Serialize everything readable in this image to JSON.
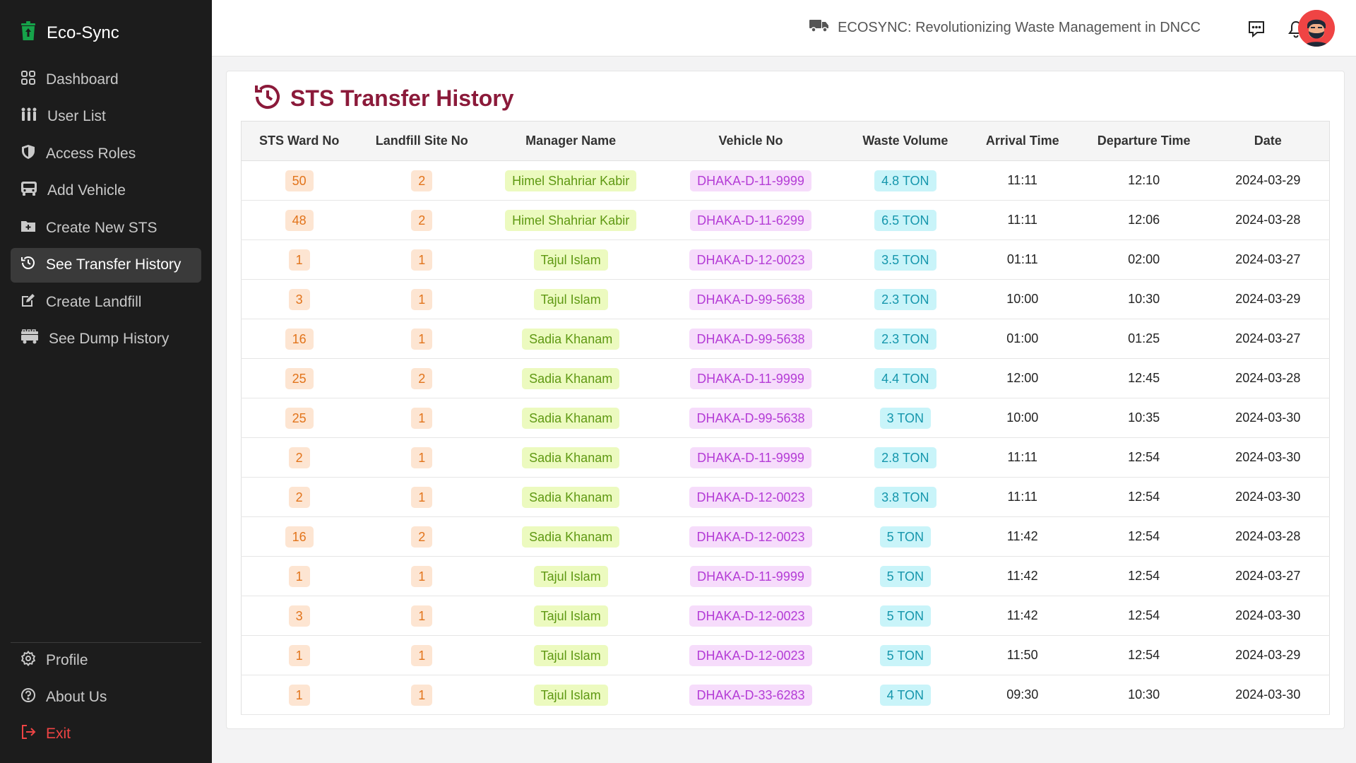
{
  "app": {
    "name": "Eco-Sync"
  },
  "sidebar": {
    "items": [
      {
        "label": "Dashboard",
        "icon": "dashboard-icon"
      },
      {
        "label": "User List",
        "icon": "users-icon"
      },
      {
        "label": "Access Roles",
        "icon": "shield-icon"
      },
      {
        "label": "Add Vehicle",
        "icon": "truck-icon"
      },
      {
        "label": "Create New STS",
        "icon": "folder-plus-icon"
      },
      {
        "label": "See Transfer History",
        "icon": "history-icon",
        "active": true
      },
      {
        "label": "Create Landfill",
        "icon": "edit-icon"
      },
      {
        "label": "See Dump History",
        "icon": "dump-truck-icon"
      }
    ],
    "bottom": [
      {
        "label": "Profile",
        "icon": "gear-icon"
      },
      {
        "label": "About Us",
        "icon": "help-icon"
      },
      {
        "label": "Exit",
        "icon": "exit-icon"
      }
    ]
  },
  "header": {
    "title": "ECOSYNC: Revolutionizing Waste Management in DNCC"
  },
  "page": {
    "title": "STS Transfer History"
  },
  "table": {
    "columns": [
      "STS Ward No",
      "Landfill Site No",
      "Manager Name",
      "Vehicle No",
      "Waste Volume",
      "Arrival Time",
      "Departure Time",
      "Date"
    ],
    "rows": [
      [
        "50",
        "2",
        "Himel Shahriar Kabir",
        "DHAKA-D-11-9999",
        "4.8 TON",
        "11:11",
        "12:10",
        "2024-03-29"
      ],
      [
        "48",
        "2",
        "Himel Shahriar Kabir",
        "DHAKA-D-11-6299",
        "6.5 TON",
        "11:11",
        "12:06",
        "2024-03-28"
      ],
      [
        "1",
        "1",
        "Tajul Islam",
        "DHAKA-D-12-0023",
        "3.5 TON",
        "01:11",
        "02:00",
        "2024-03-27"
      ],
      [
        "3",
        "1",
        "Tajul Islam",
        "DHAKA-D-99-5638",
        "2.3 TON",
        "10:00",
        "10:30",
        "2024-03-29"
      ],
      [
        "16",
        "1",
        "Sadia Khanam",
        "DHAKA-D-99-5638",
        "2.3 TON",
        "01:00",
        "01:25",
        "2024-03-27"
      ],
      [
        "25",
        "2",
        "Sadia Khanam",
        "DHAKA-D-11-9999",
        "4.4 TON",
        "12:00",
        "12:45",
        "2024-03-28"
      ],
      [
        "25",
        "1",
        "Sadia Khanam",
        "DHAKA-D-99-5638",
        "3 TON",
        "10:00",
        "10:35",
        "2024-03-30"
      ],
      [
        "2",
        "1",
        "Sadia Khanam",
        "DHAKA-D-11-9999",
        "2.8 TON",
        "11:11",
        "12:54",
        "2024-03-30"
      ],
      [
        "2",
        "1",
        "Sadia Khanam",
        "DHAKA-D-12-0023",
        "3.8 TON",
        "11:11",
        "12:54",
        "2024-03-30"
      ],
      [
        "16",
        "2",
        "Sadia Khanam",
        "DHAKA-D-12-0023",
        "5 TON",
        "11:42",
        "12:54",
        "2024-03-28"
      ],
      [
        "1",
        "1",
        "Tajul Islam",
        "DHAKA-D-11-9999",
        "5 TON",
        "11:42",
        "12:54",
        "2024-03-27"
      ],
      [
        "3",
        "1",
        "Tajul Islam",
        "DHAKA-D-12-0023",
        "5 TON",
        "11:42",
        "12:54",
        "2024-03-30"
      ],
      [
        "1",
        "1",
        "Tajul Islam",
        "DHAKA-D-12-0023",
        "5 TON",
        "11:50",
        "12:54",
        "2024-03-29"
      ],
      [
        "1",
        "1",
        "Tajul Islam",
        "DHAKA-D-33-6283",
        "4 TON",
        "09:30",
        "10:30",
        "2024-03-30"
      ]
    ]
  },
  "colors": {
    "sidebar_bg": "#1c1c1c",
    "title": "#8b1a3a",
    "exit": "#ef4444",
    "ward_pill": "#fde5d2",
    "manager_pill": "#ecfabf",
    "vehicle_pill": "#f6dcfb",
    "volume_pill": "#c9f4f9"
  }
}
